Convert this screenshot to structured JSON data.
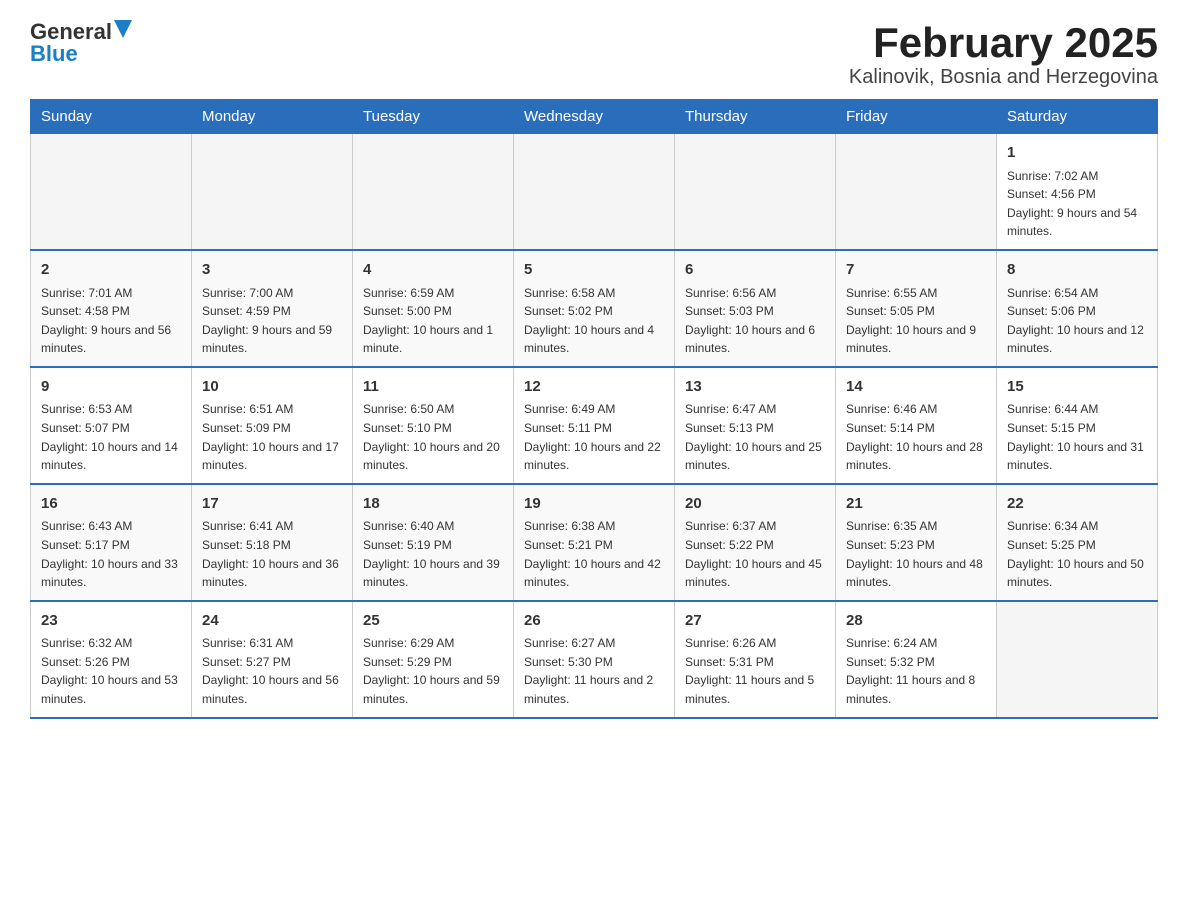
{
  "header": {
    "logo_general": "General",
    "logo_blue": "Blue",
    "title": "February 2025",
    "subtitle": "Kalinovik, Bosnia and Herzegovina"
  },
  "weekdays": [
    "Sunday",
    "Monday",
    "Tuesday",
    "Wednesday",
    "Thursday",
    "Friday",
    "Saturday"
  ],
  "weeks": [
    [
      {
        "day": "",
        "sunrise": "",
        "sunset": "",
        "daylight": ""
      },
      {
        "day": "",
        "sunrise": "",
        "sunset": "",
        "daylight": ""
      },
      {
        "day": "",
        "sunrise": "",
        "sunset": "",
        "daylight": ""
      },
      {
        "day": "",
        "sunrise": "",
        "sunset": "",
        "daylight": ""
      },
      {
        "day": "",
        "sunrise": "",
        "sunset": "",
        "daylight": ""
      },
      {
        "day": "",
        "sunrise": "",
        "sunset": "",
        "daylight": ""
      },
      {
        "day": "1",
        "sunrise": "Sunrise: 7:02 AM",
        "sunset": "Sunset: 4:56 PM",
        "daylight": "Daylight: 9 hours and 54 minutes."
      }
    ],
    [
      {
        "day": "2",
        "sunrise": "Sunrise: 7:01 AM",
        "sunset": "Sunset: 4:58 PM",
        "daylight": "Daylight: 9 hours and 56 minutes."
      },
      {
        "day": "3",
        "sunrise": "Sunrise: 7:00 AM",
        "sunset": "Sunset: 4:59 PM",
        "daylight": "Daylight: 9 hours and 59 minutes."
      },
      {
        "day": "4",
        "sunrise": "Sunrise: 6:59 AM",
        "sunset": "Sunset: 5:00 PM",
        "daylight": "Daylight: 10 hours and 1 minute."
      },
      {
        "day": "5",
        "sunrise": "Sunrise: 6:58 AM",
        "sunset": "Sunset: 5:02 PM",
        "daylight": "Daylight: 10 hours and 4 minutes."
      },
      {
        "day": "6",
        "sunrise": "Sunrise: 6:56 AM",
        "sunset": "Sunset: 5:03 PM",
        "daylight": "Daylight: 10 hours and 6 minutes."
      },
      {
        "day": "7",
        "sunrise": "Sunrise: 6:55 AM",
        "sunset": "Sunset: 5:05 PM",
        "daylight": "Daylight: 10 hours and 9 minutes."
      },
      {
        "day": "8",
        "sunrise": "Sunrise: 6:54 AM",
        "sunset": "Sunset: 5:06 PM",
        "daylight": "Daylight: 10 hours and 12 minutes."
      }
    ],
    [
      {
        "day": "9",
        "sunrise": "Sunrise: 6:53 AM",
        "sunset": "Sunset: 5:07 PM",
        "daylight": "Daylight: 10 hours and 14 minutes."
      },
      {
        "day": "10",
        "sunrise": "Sunrise: 6:51 AM",
        "sunset": "Sunset: 5:09 PM",
        "daylight": "Daylight: 10 hours and 17 minutes."
      },
      {
        "day": "11",
        "sunrise": "Sunrise: 6:50 AM",
        "sunset": "Sunset: 5:10 PM",
        "daylight": "Daylight: 10 hours and 20 minutes."
      },
      {
        "day": "12",
        "sunrise": "Sunrise: 6:49 AM",
        "sunset": "Sunset: 5:11 PM",
        "daylight": "Daylight: 10 hours and 22 minutes."
      },
      {
        "day": "13",
        "sunrise": "Sunrise: 6:47 AM",
        "sunset": "Sunset: 5:13 PM",
        "daylight": "Daylight: 10 hours and 25 minutes."
      },
      {
        "day": "14",
        "sunrise": "Sunrise: 6:46 AM",
        "sunset": "Sunset: 5:14 PM",
        "daylight": "Daylight: 10 hours and 28 minutes."
      },
      {
        "day": "15",
        "sunrise": "Sunrise: 6:44 AM",
        "sunset": "Sunset: 5:15 PM",
        "daylight": "Daylight: 10 hours and 31 minutes."
      }
    ],
    [
      {
        "day": "16",
        "sunrise": "Sunrise: 6:43 AM",
        "sunset": "Sunset: 5:17 PM",
        "daylight": "Daylight: 10 hours and 33 minutes."
      },
      {
        "day": "17",
        "sunrise": "Sunrise: 6:41 AM",
        "sunset": "Sunset: 5:18 PM",
        "daylight": "Daylight: 10 hours and 36 minutes."
      },
      {
        "day": "18",
        "sunrise": "Sunrise: 6:40 AM",
        "sunset": "Sunset: 5:19 PM",
        "daylight": "Daylight: 10 hours and 39 minutes."
      },
      {
        "day": "19",
        "sunrise": "Sunrise: 6:38 AM",
        "sunset": "Sunset: 5:21 PM",
        "daylight": "Daylight: 10 hours and 42 minutes."
      },
      {
        "day": "20",
        "sunrise": "Sunrise: 6:37 AM",
        "sunset": "Sunset: 5:22 PM",
        "daylight": "Daylight: 10 hours and 45 minutes."
      },
      {
        "day": "21",
        "sunrise": "Sunrise: 6:35 AM",
        "sunset": "Sunset: 5:23 PM",
        "daylight": "Daylight: 10 hours and 48 minutes."
      },
      {
        "day": "22",
        "sunrise": "Sunrise: 6:34 AM",
        "sunset": "Sunset: 5:25 PM",
        "daylight": "Daylight: 10 hours and 50 minutes."
      }
    ],
    [
      {
        "day": "23",
        "sunrise": "Sunrise: 6:32 AM",
        "sunset": "Sunset: 5:26 PM",
        "daylight": "Daylight: 10 hours and 53 minutes."
      },
      {
        "day": "24",
        "sunrise": "Sunrise: 6:31 AM",
        "sunset": "Sunset: 5:27 PM",
        "daylight": "Daylight: 10 hours and 56 minutes."
      },
      {
        "day": "25",
        "sunrise": "Sunrise: 6:29 AM",
        "sunset": "Sunset: 5:29 PM",
        "daylight": "Daylight: 10 hours and 59 minutes."
      },
      {
        "day": "26",
        "sunrise": "Sunrise: 6:27 AM",
        "sunset": "Sunset: 5:30 PM",
        "daylight": "Daylight: 11 hours and 2 minutes."
      },
      {
        "day": "27",
        "sunrise": "Sunrise: 6:26 AM",
        "sunset": "Sunset: 5:31 PM",
        "daylight": "Daylight: 11 hours and 5 minutes."
      },
      {
        "day": "28",
        "sunrise": "Sunrise: 6:24 AM",
        "sunset": "Sunset: 5:32 PM",
        "daylight": "Daylight: 11 hours and 8 minutes."
      },
      {
        "day": "",
        "sunrise": "",
        "sunset": "",
        "daylight": ""
      }
    ]
  ]
}
